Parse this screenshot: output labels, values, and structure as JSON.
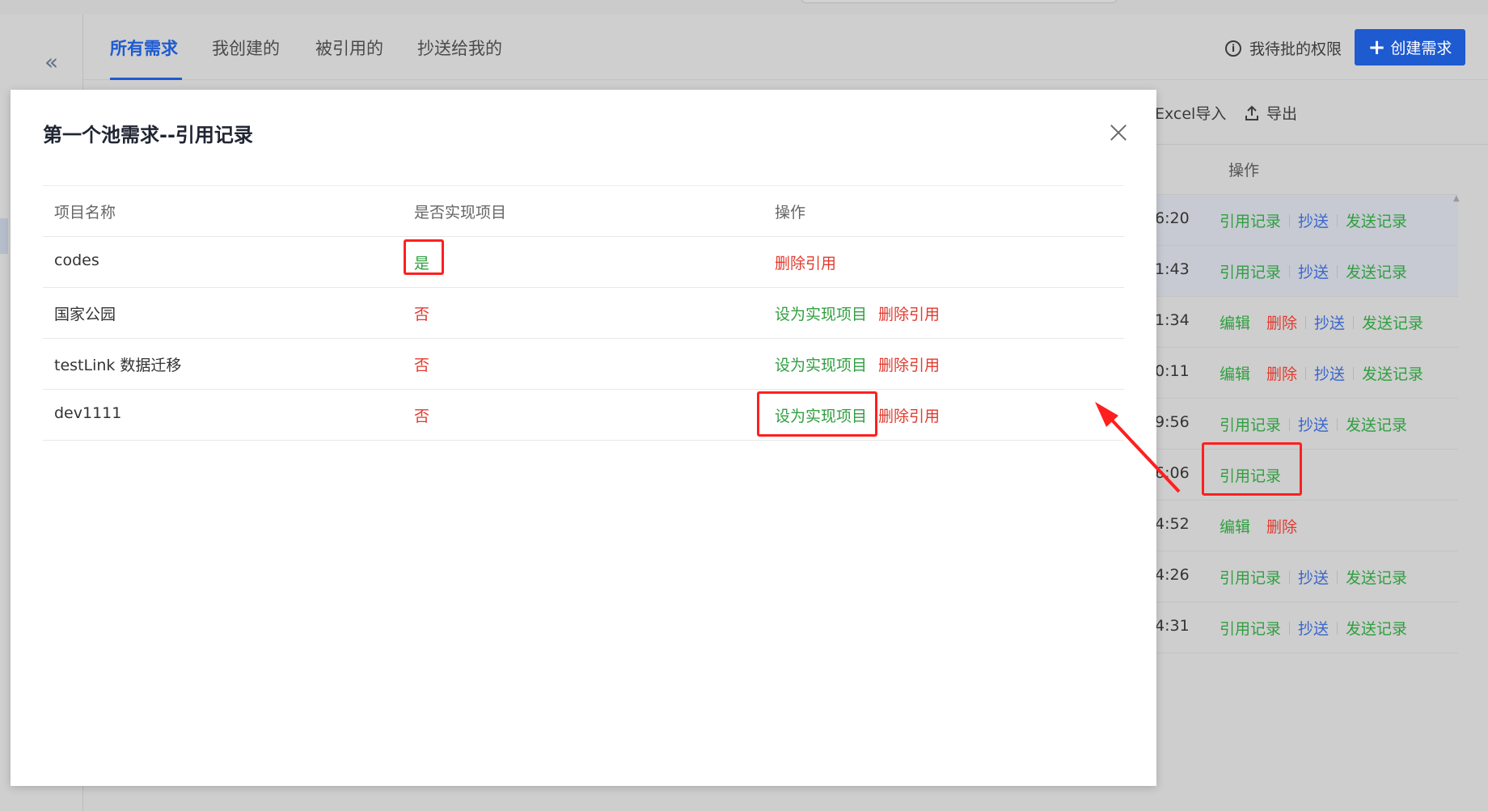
{
  "nav": {
    "collapse": "«",
    "tabs": [
      "所有需求",
      "我创建的",
      "被引用的",
      "抄送给我的"
    ],
    "pending_label": "我待批的权限",
    "create_label": "创建需求"
  },
  "toolbar": {
    "import_label": "Excel导入",
    "export_label": "导出"
  },
  "bg_table": {
    "header": "操作",
    "rows": [
      {
        "time": "6:20",
        "actions": [
          "引用记录",
          "抄送",
          "发送记录"
        ]
      },
      {
        "time": "1:43",
        "actions": [
          "引用记录",
          "抄送",
          "发送记录"
        ]
      },
      {
        "time": "1:34",
        "actions": [
          "编辑",
          "删除",
          "抄送",
          "发送记录"
        ]
      },
      {
        "time": "0:11",
        "actions": [
          "编辑",
          "删除",
          "抄送",
          "发送记录"
        ]
      },
      {
        "time": "9:56",
        "actions": [
          "引用记录",
          "抄送",
          "发送记录"
        ]
      },
      {
        "time": "6:06",
        "actions": [
          "引用记录"
        ]
      },
      {
        "time": "4:52",
        "actions": [
          "编辑",
          "删除"
        ]
      },
      {
        "time": "4:26",
        "actions": [
          "引用记录",
          "抄送",
          "发送记录"
        ]
      },
      {
        "time": "4:31",
        "actions": [
          "引用记录",
          "抄送",
          "发送记录"
        ]
      }
    ]
  },
  "modal": {
    "title": "第一个池需求--引用记录",
    "columns": [
      "项目名称",
      "是否实现项目",
      "操作"
    ],
    "rows": [
      {
        "name": "codes",
        "status": "是",
        "set_label": "",
        "delete_label": "删除引用"
      },
      {
        "name": "国家公园",
        "status": "否",
        "set_label": "设为实现项目",
        "delete_label": "删除引用"
      },
      {
        "name": "testLink 数据迁移",
        "status": "否",
        "set_label": "设为实现项目",
        "delete_label": "删除引用"
      },
      {
        "name": "dev1111",
        "status": "否",
        "set_label": "设为实现项目",
        "delete_label": "删除引用"
      }
    ]
  },
  "colors": {
    "primary": "#1e5ad0",
    "green": "#2f9f3f",
    "red": "#e23a2e",
    "blue": "#3a66cc",
    "annotation": "#ff1f1f"
  }
}
